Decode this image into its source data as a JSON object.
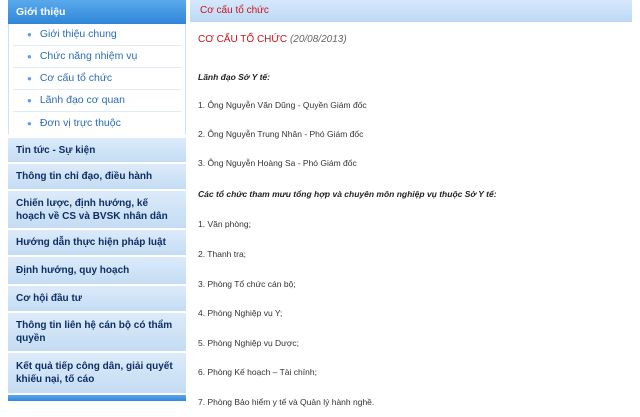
{
  "sidebar": {
    "section_title": "Giới thiệu",
    "sub_items": [
      {
        "label": "Giới thiệu chung"
      },
      {
        "label": "Chức năng nhiệm vụ"
      },
      {
        "label": "Cơ cấu tổ chức"
      },
      {
        "label": "Lãnh đạo cơ quan"
      },
      {
        "label": "Đơn vị trực thuộc"
      }
    ],
    "categories": [
      {
        "label": "Tin tức - Sự kiện"
      },
      {
        "label": "Thông tin chỉ đạo, điều hành"
      },
      {
        "label": "Chiến lược, định hướng, kế hoạch về CS và BVSK nhân dân"
      },
      {
        "label": "Hướng dẫn thực hiện pháp luật"
      },
      {
        "label": "Định hướng, quy hoạch"
      },
      {
        "label": "Cơ hội đầu tư"
      },
      {
        "label": "Thông tin liên hệ cán bộ có thẩm quyền"
      },
      {
        "label": "Kết quả tiếp công dân, giải quyết khiếu nại, tố cáo"
      }
    ]
  },
  "content": {
    "header": "Cơ cấu tổ chức",
    "title": "CƠ CẤU TỔ CHỨC",
    "date": "(20/08/2013)",
    "leadership_heading": "Lãnh đạo Sở Y tế:",
    "leaders": [
      "1. Ông Nguyễn Văn Dũng - Quyền Giám đốc",
      "2. Ông Nguyễn Trung Nhân - Phó Giám đốc",
      "3. Ông Nguyễn Hoàng Sa - Phó Giám đốc"
    ],
    "departments_heading": "Các tổ chức tham mưu tổng hợp và chuyên môn nghiệp vụ thuộc Sở Y tế:",
    "departments": [
      "1. Văn phòng;",
      "2. Thanh tra;",
      "3. Phòng Tổ chức cán bộ;",
      "4. Phòng Nghiệp vụ Y;",
      "5. Phòng Nghiệp vụ Dược;",
      "6. Phòng Kế hoạch – Tài chính;",
      "7. Phòng Bảo hiểm y tế và Quản lý hành nghề."
    ]
  },
  "colors": {
    "accent_blue": "#2f86d9",
    "header_red": "#c9141a",
    "category_bg": "#c4dcf3"
  }
}
